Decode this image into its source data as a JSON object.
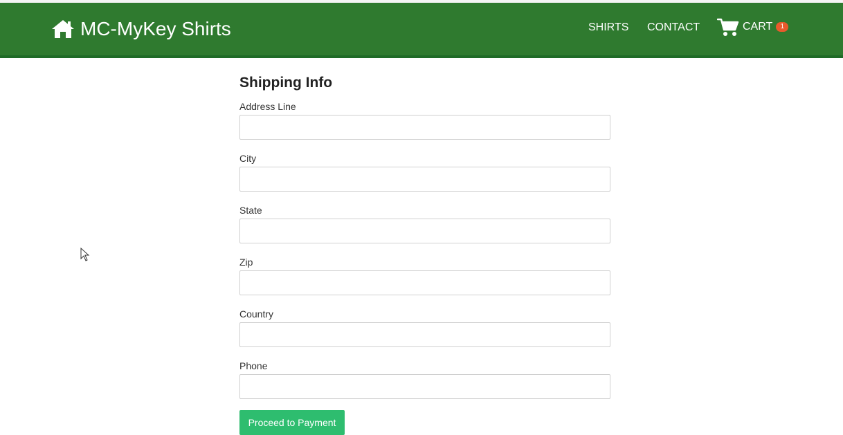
{
  "header": {
    "brand": "MC-MyKey Shirts",
    "nav": {
      "shirts": "SHIRTS",
      "contact": "CONTACT",
      "cart": "CART",
      "cart_count": "1"
    }
  },
  "form": {
    "title": "Shipping Info",
    "fields": [
      {
        "label": "Address Line",
        "value": ""
      },
      {
        "label": "City",
        "value": ""
      },
      {
        "label": "State",
        "value": ""
      },
      {
        "label": "Zip",
        "value": ""
      },
      {
        "label": "Country",
        "value": ""
      },
      {
        "label": "Phone",
        "value": ""
      }
    ],
    "submit_label": "Proceed to Payment"
  },
  "colors": {
    "navbar": "#2f7a2f",
    "button": "#2ebd6f",
    "badge": "#e85a2c"
  },
  "icons": {
    "brand": "home-icon",
    "cart": "shopping-cart-icon",
    "cursor": "mouse-pointer-icon"
  }
}
